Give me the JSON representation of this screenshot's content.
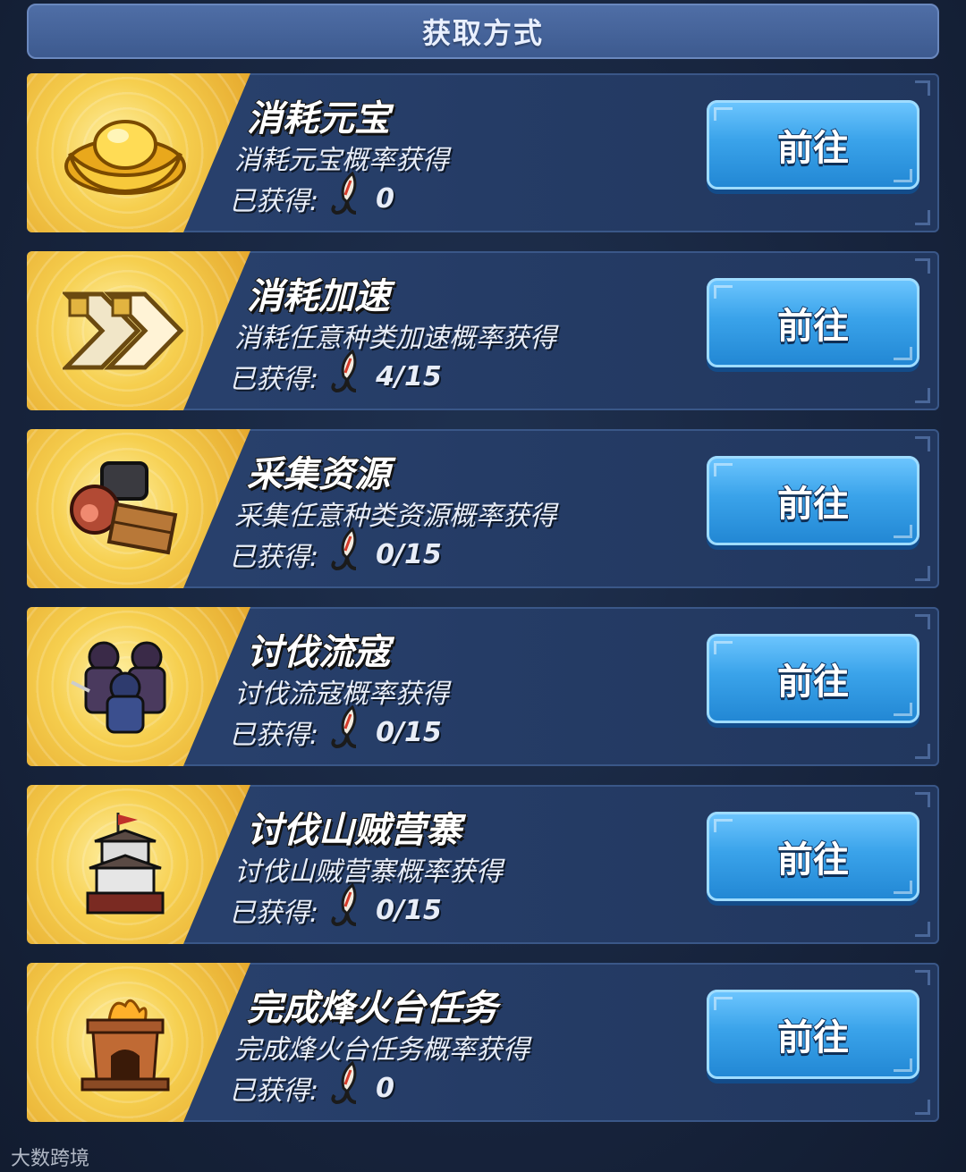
{
  "header": {
    "title": "获取方式"
  },
  "acquired_label": "已获得:",
  "go_label": "前往",
  "items": [
    {
      "title": "消耗元宝",
      "desc": "消耗元宝概率获得",
      "count": "0",
      "icon": "gold-ingot-icon"
    },
    {
      "title": "消耗加速",
      "desc": "消耗任意种类加速概率获得",
      "count": "4/15",
      "icon": "speedup-arrows-icon"
    },
    {
      "title": "采集资源",
      "desc": "采集任意种类资源概率获得",
      "count": "0/15",
      "icon": "resources-icon"
    },
    {
      "title": "讨伐流寇",
      "desc": "讨伐流寇概率获得",
      "count": "0/15",
      "icon": "bandit-soldiers-icon"
    },
    {
      "title": "讨伐山贼营寨",
      "desc": "讨伐山贼营寨概率获得",
      "count": "0/15",
      "icon": "bandit-fort-icon"
    },
    {
      "title": "完成烽火台任务",
      "desc": "完成烽火台任务概率获得",
      "count": "0",
      "icon": "beacon-tower-icon"
    }
  ],
  "watermark": "大数跨境"
}
